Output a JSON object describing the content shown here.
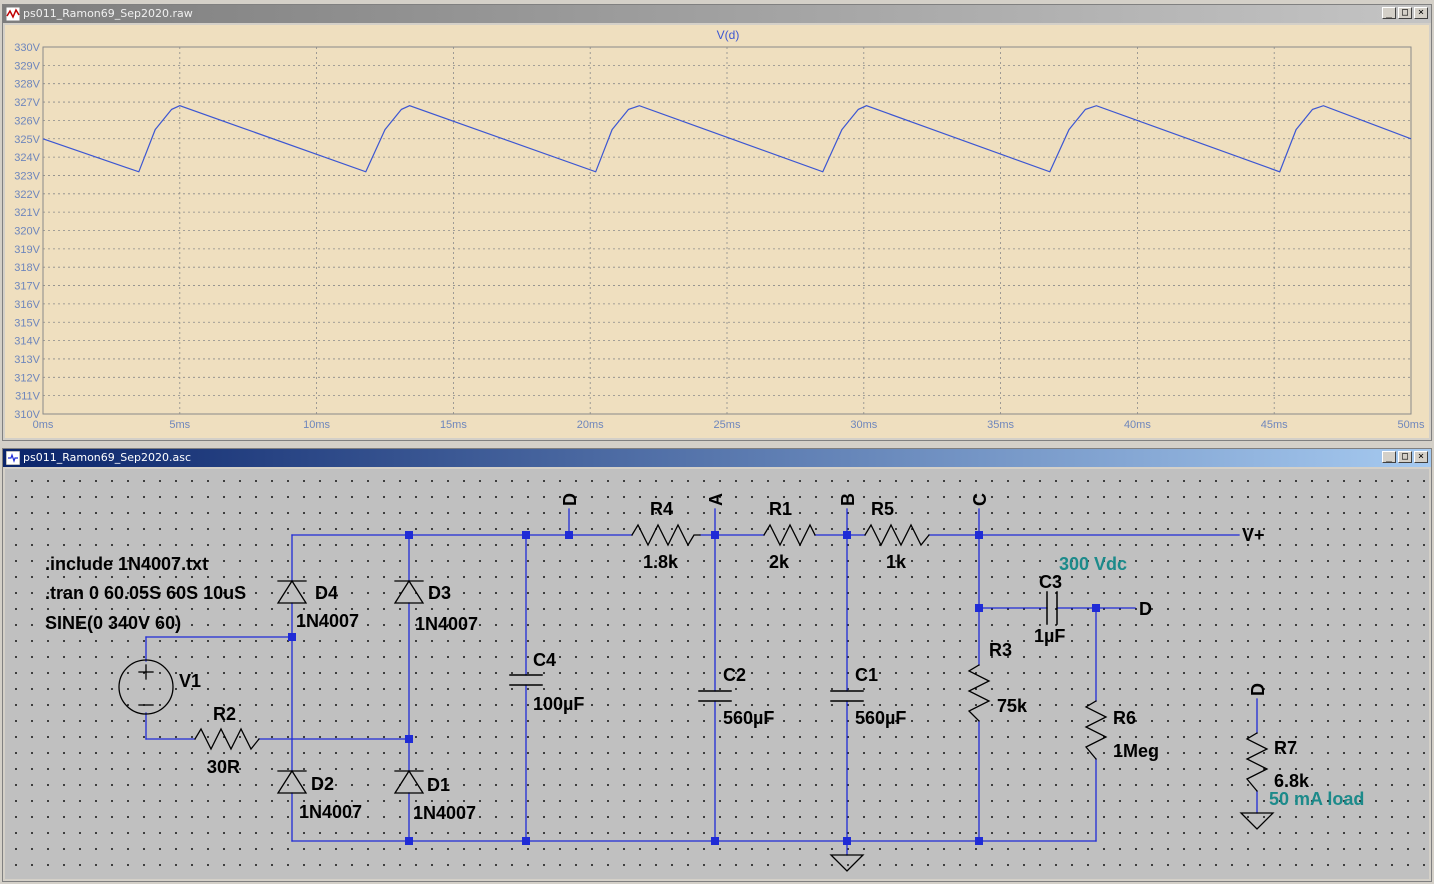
{
  "waveform_window": {
    "title": "ps011_Ramon69_Sep2020.raw",
    "trace_label": "V(d)",
    "colors": {
      "background": "#efdfbf",
      "trace": "#3c56d2",
      "grid": "#8a8a8a",
      "axis_text": "#6e86bc"
    },
    "buttons": {
      "minimize": "_",
      "maximize": "□",
      "close": "×"
    },
    "chart_data": {
      "type": "line",
      "title": "V(d)",
      "xlabel": "",
      "ylabel": "",
      "xlim": [
        0,
        50
      ],
      "ylim": [
        310,
        330
      ],
      "x_ticks": [
        "0ms",
        "5ms",
        "10ms",
        "15ms",
        "20ms",
        "25ms",
        "30ms",
        "35ms",
        "40ms",
        "45ms",
        "50ms"
      ],
      "y_ticks": [
        "330V",
        "329V",
        "328V",
        "327V",
        "326V",
        "325V",
        "324V",
        "323V",
        "322V",
        "321V",
        "320V",
        "319V",
        "318V",
        "317V",
        "316V",
        "315V",
        "314V",
        "313V",
        "312V",
        "311V",
        "310V"
      ],
      "grid": true,
      "series": [
        {
          "x_ms": [
            0,
            3.5,
            4.1,
            4.7,
            5.0,
            11.8,
            12.5,
            13.1,
            13.4,
            20.2,
            20.8,
            21.4,
            21.8,
            28.5,
            29.2,
            29.8,
            30.1,
            36.8,
            37.5,
            38.1,
            38.5,
            45.2,
            45.8,
            46.4,
            46.8,
            50
          ],
          "y_v": [
            325,
            323.2,
            325.5,
            326.6,
            326.8,
            323.2,
            325.5,
            326.6,
            326.8,
            323.2,
            325.5,
            326.6,
            326.8,
            323.2,
            325.5,
            326.6,
            326.8,
            323.2,
            325.5,
            326.6,
            326.8,
            323.2,
            325.5,
            326.6,
            326.8,
            325
          ]
        }
      ]
    }
  },
  "schematic_window": {
    "title": "ps011_Ramon69_Sep2020.asc",
    "buttons": {
      "minimize": "_",
      "maximize": "□",
      "close": "×"
    },
    "colors": {
      "background": "#c0c0c0",
      "wire": "#1f2bd6",
      "junction": "#1f2bd6",
      "text": "#000000",
      "comment": "#1c8a8a"
    },
    "directives": [
      ".include 1N4007.txt",
      ".tran 0 60.05S 60S 10uS",
      "SINE(0 340V 60)"
    ],
    "comments": [
      "300 Vdc",
      "50 mA load"
    ],
    "net_labels": {
      "d_top": "D",
      "a": "A",
      "b": "B",
      "c": "C",
      "d_right": "D",
      "d_load": "D",
      "vplus": "V+"
    },
    "components": {
      "V1": {
        "name": "V1"
      },
      "R2": {
        "name": "R2",
        "value": "30R"
      },
      "D1": {
        "name": "D1",
        "value": "1N4007"
      },
      "D2": {
        "name": "D2",
        "value": "1N4007"
      },
      "D3": {
        "name": "D3",
        "value": "1N4007"
      },
      "D4": {
        "name": "D4",
        "value": "1N4007"
      },
      "C4": {
        "name": "C4",
        "value": "100µF"
      },
      "R4": {
        "name": "R4",
        "value": "1.8k"
      },
      "C2": {
        "name": "C2",
        "value": "560µF"
      },
      "R1": {
        "name": "R1",
        "value": "2k"
      },
      "C1": {
        "name": "C1",
        "value": "560µF"
      },
      "R5": {
        "name": "R5",
        "value": "1k"
      },
      "C3": {
        "name": "C3",
        "value": "1µF"
      },
      "R3": {
        "name": "R3",
        "value": "75k"
      },
      "R6": {
        "name": "R6",
        "value": "1Meg"
      },
      "R7": {
        "name": "R7",
        "value": "6.8k"
      }
    }
  }
}
